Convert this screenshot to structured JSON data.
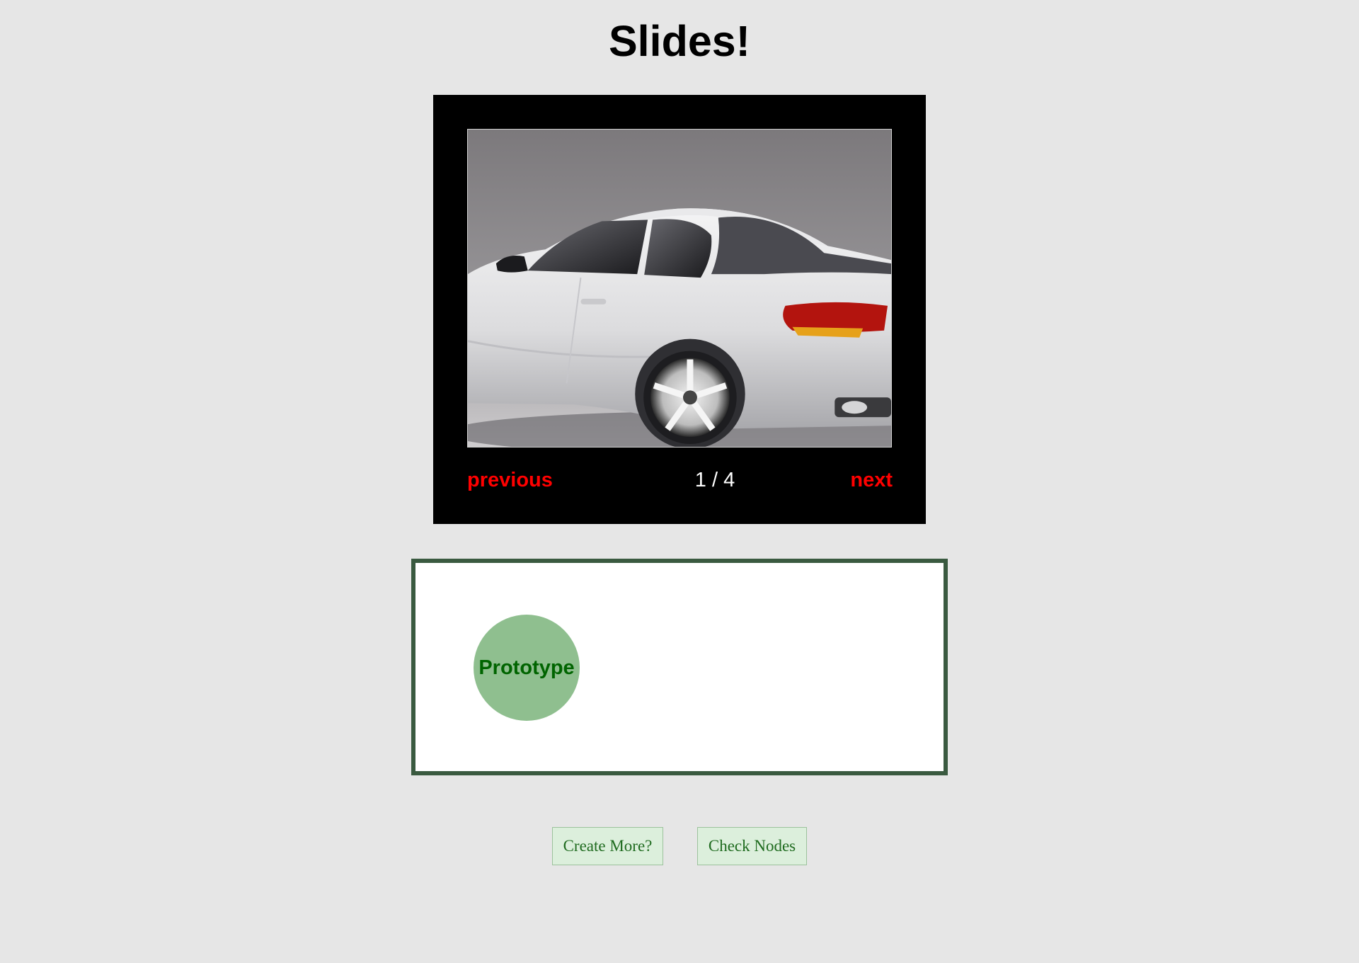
{
  "page": {
    "title": "Slides!"
  },
  "slideshow": {
    "image_subject": "white coupe car photo",
    "previous_label": "previous",
    "next_label": "next",
    "counter": "1 / 4",
    "nav_color": "#ff0000"
  },
  "node_canvas": {
    "border_color": "#3a5a40",
    "nodes": [
      {
        "label": "Prototype",
        "fill": "#8fbf8f",
        "text_color": "#006400"
      }
    ]
  },
  "actions": {
    "create_more_label": "Create More?",
    "check_nodes_label": "Check Nodes"
  }
}
